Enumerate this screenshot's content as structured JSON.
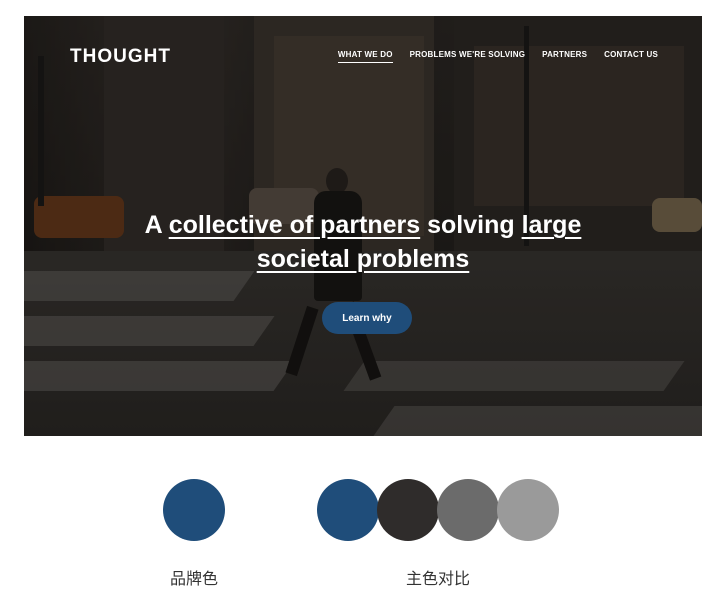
{
  "header": {
    "logo": "THOUGHT",
    "nav": [
      {
        "label": "WHAT WE DO",
        "active": true
      },
      {
        "label": "PROBLEMS WE'RE SOLVING",
        "active": false
      },
      {
        "label": "PARTNERS",
        "active": false
      },
      {
        "label": "CONTACT US",
        "active": false
      }
    ]
  },
  "hero": {
    "headline_parts": [
      {
        "text": "A ",
        "u": false
      },
      {
        "text": "collective of partners",
        "u": true
      },
      {
        "text": " solving ",
        "u": false
      },
      {
        "text": "large",
        "u": true
      },
      {
        "text": "societal problems",
        "u": true
      }
    ],
    "cta_label": "Learn why"
  },
  "palette": {
    "brand_color": "#1f4d7a",
    "contrast_colors": [
      "#1f4d7a",
      "#2f2c2b",
      "#6b6b6b",
      "#9a9a9a"
    ],
    "brand_caption": "品牌色",
    "contrast_caption": "主色对比"
  }
}
